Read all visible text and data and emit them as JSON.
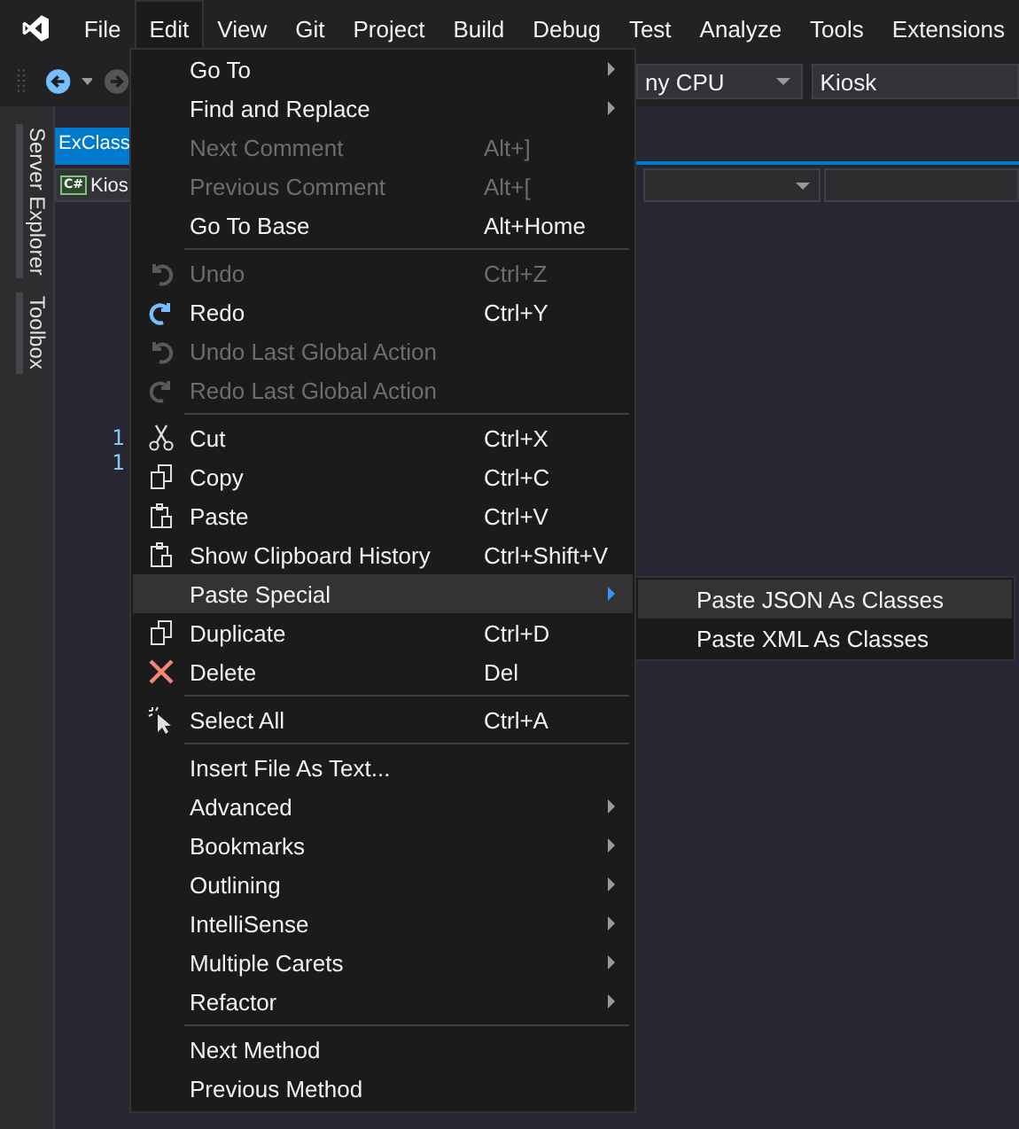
{
  "menubar": [
    {
      "label": "File",
      "selected": false
    },
    {
      "label": "Edit",
      "selected": true
    },
    {
      "label": "View",
      "selected": false
    },
    {
      "label": "Git",
      "selected": false
    },
    {
      "label": "Project",
      "selected": false
    },
    {
      "label": "Build",
      "selected": false
    },
    {
      "label": "Debug",
      "selected": false
    },
    {
      "label": "Test",
      "selected": false
    },
    {
      "label": "Analyze",
      "selected": false
    },
    {
      "label": "Tools",
      "selected": false
    },
    {
      "label": "Extensions",
      "selected": false
    }
  ],
  "toolbar": {
    "platform": "ny CPU",
    "startup_project": "Kiosk"
  },
  "side_tabs": [
    "Server Explorer",
    "Toolbox"
  ],
  "editor": {
    "tab": "ExClass",
    "language_badge": "C#",
    "project": "Kios",
    "line_numbers": [
      "1",
      "1"
    ]
  },
  "edit_menu": [
    {
      "kind": "item",
      "label": "Go To",
      "disabled": false,
      "selected": false,
      "has_submenu": true
    },
    {
      "kind": "item",
      "label": "Find and Replace",
      "disabled": false,
      "selected": false,
      "has_submenu": true
    },
    {
      "kind": "item",
      "label": "Next Comment",
      "shortcut": "Alt+]",
      "disabled": true,
      "selected": false,
      "has_submenu": false
    },
    {
      "kind": "item",
      "label": "Previous Comment",
      "shortcut": "Alt+[",
      "disabled": true,
      "selected": false,
      "has_submenu": false
    },
    {
      "kind": "item",
      "label": "Go To Base",
      "shortcut": "Alt+Home",
      "disabled": false,
      "selected": false,
      "has_submenu": false
    },
    {
      "kind": "separator"
    },
    {
      "kind": "item",
      "label": "Undo",
      "shortcut": "Ctrl+Z",
      "disabled": true,
      "selected": false,
      "has_submenu": false
    },
    {
      "kind": "item",
      "label": "Redo",
      "shortcut": "Ctrl+Y",
      "disabled": false,
      "selected": false,
      "has_submenu": false
    },
    {
      "kind": "item",
      "label": "Undo Last Global Action",
      "disabled": true,
      "selected": false,
      "has_submenu": false
    },
    {
      "kind": "item",
      "label": "Redo Last Global Action",
      "disabled": true,
      "selected": false,
      "has_submenu": false
    },
    {
      "kind": "separator"
    },
    {
      "kind": "item",
      "label": "Cut",
      "shortcut": "Ctrl+X",
      "disabled": false,
      "selected": false,
      "has_submenu": false
    },
    {
      "kind": "item",
      "label": "Copy",
      "shortcut": "Ctrl+C",
      "disabled": false,
      "selected": false,
      "has_submenu": false
    },
    {
      "kind": "item",
      "label": "Paste",
      "shortcut": "Ctrl+V",
      "disabled": false,
      "selected": false,
      "has_submenu": false
    },
    {
      "kind": "item",
      "label": "Show Clipboard History",
      "shortcut": "Ctrl+Shift+V",
      "disabled": false,
      "selected": false,
      "has_submenu": false
    },
    {
      "kind": "item",
      "label": "Paste Special",
      "disabled": false,
      "selected": true,
      "has_submenu": true
    },
    {
      "kind": "item",
      "label": "Duplicate",
      "shortcut": "Ctrl+D",
      "disabled": false,
      "selected": false,
      "has_submenu": false
    },
    {
      "kind": "item",
      "label": "Delete",
      "shortcut": "Del",
      "disabled": false,
      "selected": false,
      "has_submenu": false
    },
    {
      "kind": "separator"
    },
    {
      "kind": "item",
      "label": "Select All",
      "shortcut": "Ctrl+A",
      "disabled": false,
      "selected": false,
      "has_submenu": false
    },
    {
      "kind": "separator"
    },
    {
      "kind": "item",
      "label": "Insert File As Text...",
      "disabled": false,
      "selected": false,
      "has_submenu": false
    },
    {
      "kind": "item",
      "label": "Advanced",
      "disabled": false,
      "selected": false,
      "has_submenu": true
    },
    {
      "kind": "item",
      "label": "Bookmarks",
      "disabled": false,
      "selected": false,
      "has_submenu": true
    },
    {
      "kind": "item",
      "label": "Outlining",
      "disabled": false,
      "selected": false,
      "has_submenu": true
    },
    {
      "kind": "item",
      "label": "IntelliSense",
      "disabled": false,
      "selected": false,
      "has_submenu": true
    },
    {
      "kind": "item",
      "label": "Multiple Carets",
      "disabled": false,
      "selected": false,
      "has_submenu": true
    },
    {
      "kind": "item",
      "label": "Refactor",
      "disabled": false,
      "selected": false,
      "has_submenu": true
    },
    {
      "kind": "separator"
    },
    {
      "kind": "item",
      "label": "Next Method",
      "disabled": false,
      "selected": false,
      "has_submenu": false
    },
    {
      "kind": "item",
      "label": "Previous Method",
      "disabled": false,
      "selected": false,
      "has_submenu": false
    }
  ],
  "submenu": [
    {
      "label": "Paste JSON As Classes",
      "selected": true
    },
    {
      "label": "Paste XML As Classes",
      "selected": false
    }
  ]
}
